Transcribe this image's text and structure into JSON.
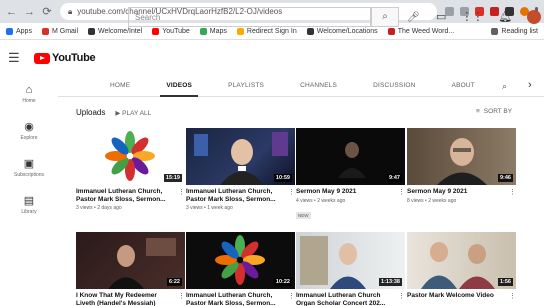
{
  "browser": {
    "url": "youtube.com/channel/UCxHVDrqLaorHzfB2/L2-OJ/videos",
    "bookmarks": [
      "Apps",
      "M Gmail",
      "Welcome/Intel",
      "YouTube",
      "Maps",
      "Redirect Sign In",
      "Welcome/Locations",
      "The Weed Word...",
      "Reading list"
    ]
  },
  "youtube": {
    "logo_text": "YouTube",
    "search_placeholder": "Search",
    "guide": [
      {
        "icon": "home-icon",
        "glyph": "⌂",
        "label": "Home"
      },
      {
        "icon": "explore-icon",
        "glyph": "◉",
        "label": "Explore"
      },
      {
        "icon": "subscriptions-icon",
        "glyph": "▣",
        "label": "Subscriptions"
      },
      {
        "icon": "library-icon",
        "glyph": "▤",
        "label": "Library"
      }
    ],
    "tabs": [
      "HOME",
      "VIDEOS",
      "PLAYLISTS",
      "CHANNELS",
      "DISCUSSION",
      "ABOUT"
    ],
    "active_tab": "VIDEOS",
    "uploads_label": "Uploads",
    "play_all": "PLAY ALL",
    "sort_by": "SORT BY"
  },
  "videos": [
    {
      "title": "Immanuel Lutheran Church, Pastor Mark Sloss, Sermon...",
      "meta": "3 views • 2 days ago",
      "duration": "15:19",
      "thumb": "logo",
      "badge": ""
    },
    {
      "title": "Immanuel Lutheran Church, Pastor Mark Sloss, Sermon...",
      "meta": "3 views • 1 week ago",
      "duration": "10:59",
      "thumb": "pastor",
      "badge": ""
    },
    {
      "title": "Sermon May 9 2021",
      "meta": "4 views • 2 weeks ago",
      "duration": "9:47",
      "thumb": "dark",
      "badge": "NEW"
    },
    {
      "title": "Sermon May 9 2021",
      "meta": "8 views • 2 weeks ago",
      "duration": "9:46",
      "thumb": "person",
      "badge": ""
    },
    {
      "title": "I Know That My Redeemer Liveth (Handel's Messiah)",
      "meta": "",
      "duration": "6:22",
      "thumb": "singer",
      "badge": ""
    },
    {
      "title": "Immanuel Lutheran Church, Pastor Mark Sloss, Sermon...",
      "meta": "",
      "duration": "10:22",
      "thumb": "logo",
      "badge": ""
    },
    {
      "title": "Immanuel Lutheran Church Organ Scholar Concert 202...",
      "meta": "",
      "duration": "1:13:38",
      "thumb": "organ",
      "badge": ""
    },
    {
      "title": "Pastor Mark Welcome Video",
      "meta": "",
      "duration": "1:56",
      "thumb": "welcome",
      "badge": ""
    }
  ],
  "colors": {
    "yt_red": "#ff0000",
    "tab_bg": "#dee1e6"
  }
}
